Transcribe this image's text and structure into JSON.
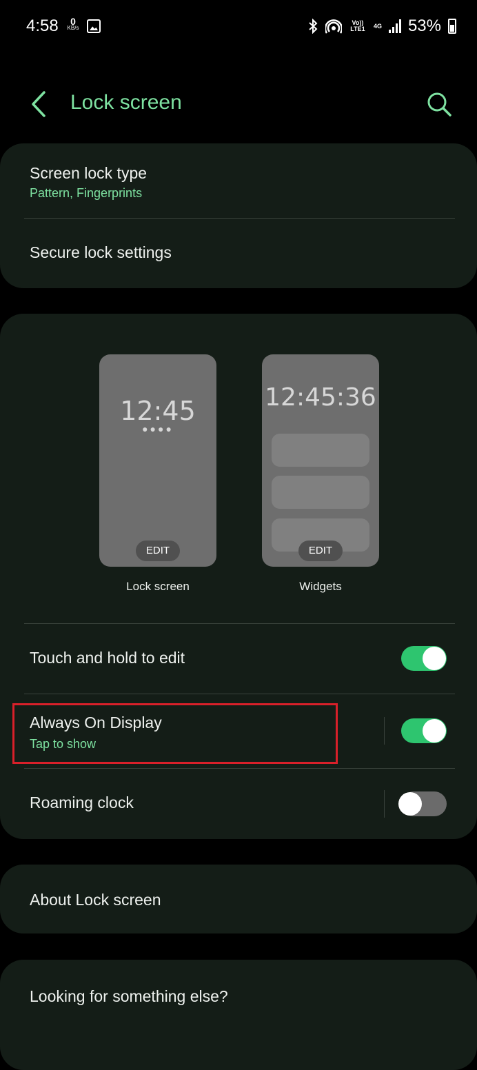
{
  "status_bar": {
    "time": "4:58",
    "net_speed_value": "0",
    "net_speed_unit": "KB/s",
    "volte_label": "Vo)) LTE1",
    "network_type": "4G",
    "battery_percent": "53%"
  },
  "header": {
    "title": "Lock screen"
  },
  "security": {
    "screen_lock_type_label": "Screen lock type",
    "screen_lock_type_value": "Pattern, Fingerprints",
    "secure_lock_settings_label": "Secure lock settings"
  },
  "previews": {
    "lock_screen": {
      "clock": "12:45",
      "edit_label": "EDIT",
      "caption": "Lock screen"
    },
    "widgets": {
      "clock": "12:45:36",
      "edit_label": "EDIT",
      "caption": "Widgets"
    }
  },
  "settings": {
    "touch_hold": {
      "label": "Touch and hold to edit",
      "enabled": true
    },
    "aod": {
      "label": "Always On Display",
      "subtitle": "Tap to show",
      "enabled": true
    },
    "roaming_clock": {
      "label": "Roaming clock",
      "enabled": false
    }
  },
  "about": {
    "label": "About Lock screen"
  },
  "looking": {
    "label": "Looking for something else?"
  },
  "colors": {
    "accent": "#7ee2a1",
    "toggle_on": "#2ec56f",
    "highlight": "#d9202a"
  }
}
